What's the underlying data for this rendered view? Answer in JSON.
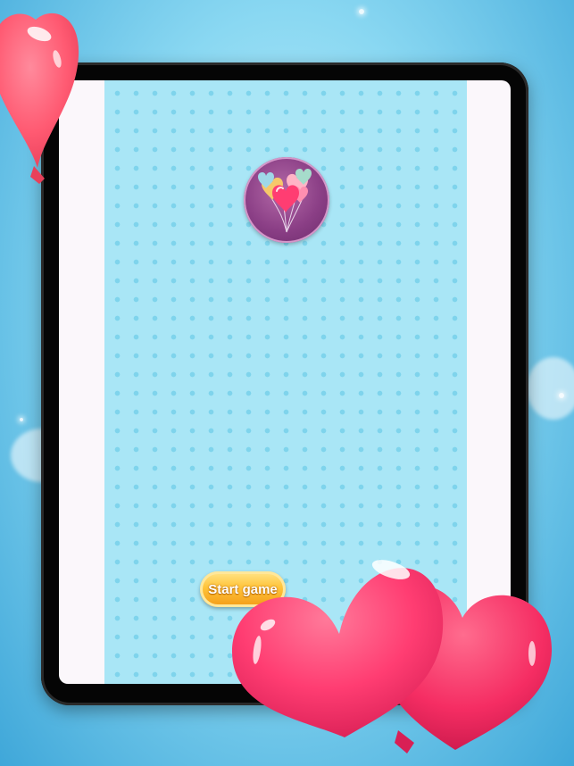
{
  "app": {
    "start_button_label": "Start game",
    "logo_icon": "heart-balloons-icon",
    "colors": {
      "sky": "#8ad8f2",
      "game_area": "#a9e6f6",
      "dots": "#7fd4ec",
      "logo_circle": "#8b3f86",
      "balloon_pink": "#ff3d72",
      "button_gold": "#ffc43a"
    }
  }
}
